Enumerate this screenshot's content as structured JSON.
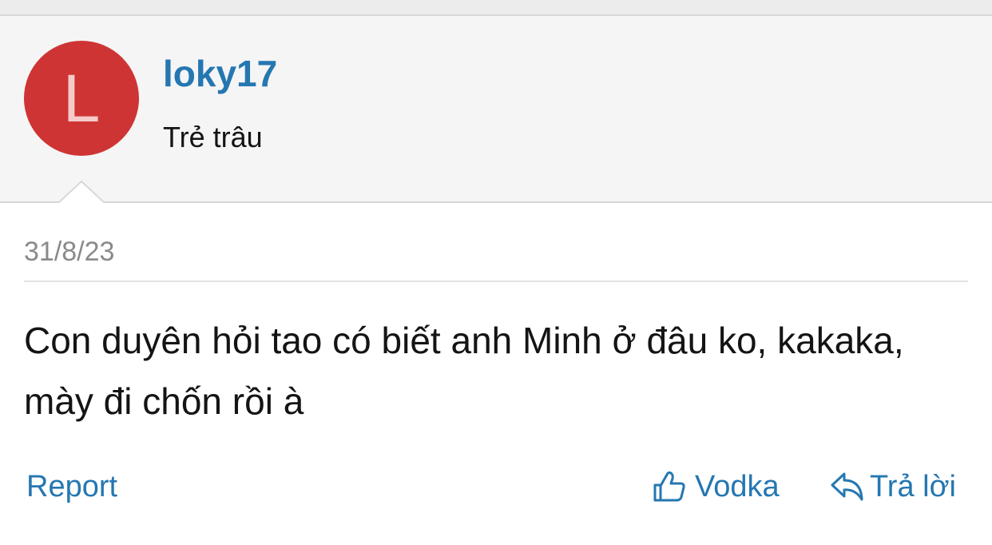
{
  "post": {
    "author": {
      "avatar_letter": "L",
      "avatar_color": "#cf3434",
      "username": "loky17",
      "title": "Trẻ trâu"
    },
    "date": "31/8/23",
    "message": "Con duyên hỏi tao có biết anh Minh ở đâu ko, kakaka, mày đi chốn rồi à"
  },
  "actions": {
    "report_label": "Report",
    "like_icon": "thumbs-up-icon",
    "like_label": "Vodka",
    "reply_icon": "reply-arrow-icon",
    "reply_label": "Trả lời"
  },
  "colors": {
    "link": "#2577b1",
    "header_bg": "#f5f5f5"
  }
}
